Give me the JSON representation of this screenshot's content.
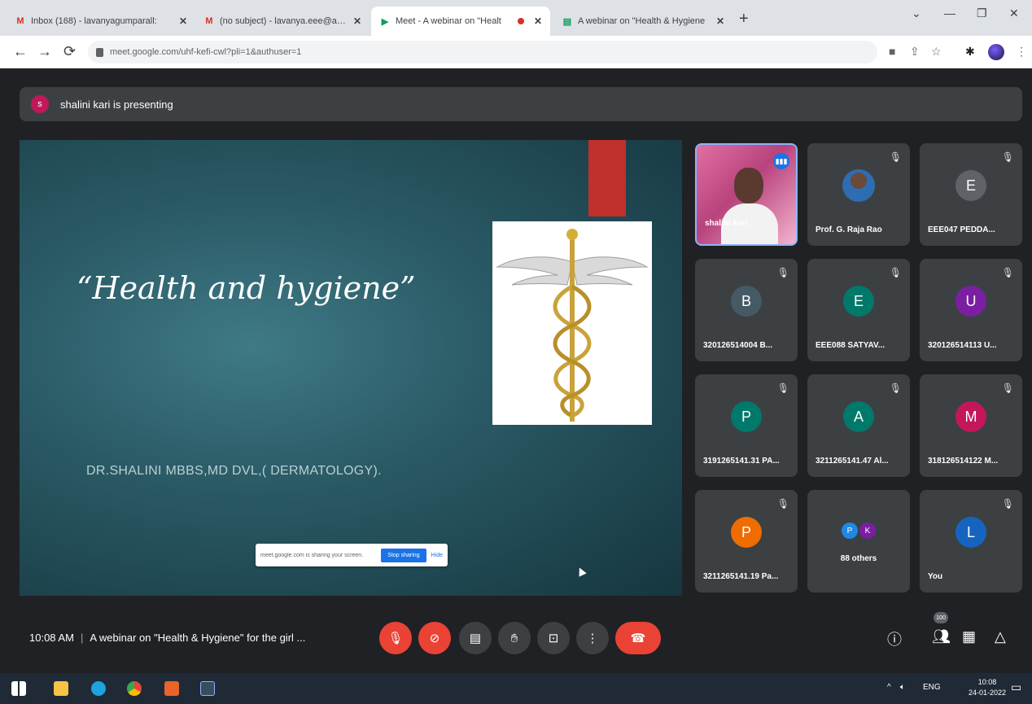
{
  "browser": {
    "tabs": [
      {
        "icon": "gmail-icon",
        "title": "Inbox (168) - lavanyagumparall:"
      },
      {
        "icon": "gmail-icon",
        "title": "(no subject) - lavanya.eee@anits"
      },
      {
        "icon": "meet-icon",
        "title": "Meet - A webinar on \"Healt"
      },
      {
        "icon": "docs-icon",
        "title": "A webinar on \"Health & Hygiene"
      }
    ],
    "new_tab": "+",
    "url": "meet.google.com/uhf-kefi-cwl?pli=1&authuser=1"
  },
  "banner": {
    "avatar_letter": "s",
    "text": "shalini kari is presenting"
  },
  "slide": {
    "title": "“Health and hygiene”",
    "subtitle": "DR.SHALINI MBBS,MD DVL,( DERMATOLOGY).",
    "share_message": "meet.google.com is sharing your screen.",
    "stop_sharing": "Stop sharing",
    "hide": "Hide"
  },
  "participants": [
    {
      "name": "shalini kari",
      "type": "video"
    },
    {
      "name": "Prof. G. Raja Rao",
      "type": "photo"
    },
    {
      "name": "EEE047 PEDDA...",
      "letter": "E",
      "color": "#5f6368"
    },
    {
      "name": "320126514004 B...",
      "letter": "B",
      "color": "#455a64"
    },
    {
      "name": "EEE088 SATYAV...",
      "letter": "E",
      "color": "#00796b"
    },
    {
      "name": "320126514113 U...",
      "letter": "U",
      "color": "#7b1fa2"
    },
    {
      "name": "3191265141.31 PA...",
      "letter": "P",
      "color": "#00796b"
    },
    {
      "name": "3211265141.47 Al...",
      "letter": "A",
      "color": "#00796b"
    },
    {
      "name": "318126514122 M...",
      "letter": "M",
      "color": "#c2185b"
    },
    {
      "name": "3211265141.19 Pa...",
      "letter": "P",
      "color": "#ef6c00"
    },
    {
      "name": "88 others",
      "type": "others",
      "mini": [
        "P",
        "K"
      ]
    },
    {
      "name": "You",
      "letter": "L",
      "color": "#1565c0"
    }
  ],
  "bottom": {
    "time": "10:08 AM",
    "meeting_title": "A webinar on \"Health & Hygiene\" for the girl ...",
    "people_count": "100"
  },
  "taskbar": {
    "lang": "ENG",
    "time": "10:08",
    "date": "24-01-2022"
  }
}
